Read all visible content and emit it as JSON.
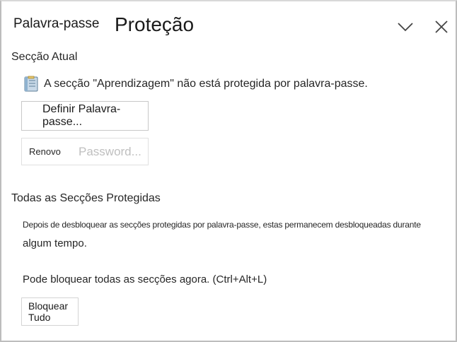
{
  "header": {
    "tab_label": "Palavra-passe",
    "title": "Proteção",
    "collapse_icon": "chevron-down-icon",
    "close_icon": "close-icon"
  },
  "current_section": {
    "heading": "Secção Atual",
    "notebook_icon": "notebook-section-icon",
    "status": "A secção \"Aprendizagem\" não está protegida por palavra-passe.",
    "set_password_label": "Definir Palavra-passe...",
    "renew_label": "Renovo",
    "renew_disabled_text": "Password..."
  },
  "all_sections": {
    "heading": "Todas as Secções Protegidas",
    "description_line1": "Depois de desbloquear as secções protegidas por palavra-passe, estas permanecem desbloqueadas durante",
    "description_line2": "algum tempo.",
    "lock_hint": "Pode bloquear todas as secções agora. (Ctrl+Alt+L)",
    "lock_all_label": "Bloquear Tudo"
  },
  "colors": {
    "text": "#262626",
    "border": "#bdbdbd",
    "disabled_text": "#bfbfbf",
    "notebook_icon_fill": "#8fb2cf"
  }
}
